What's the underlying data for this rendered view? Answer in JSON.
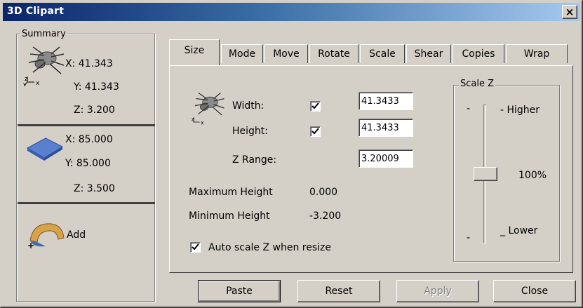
{
  "window": {
    "title": "3D Clipart",
    "close_glyph": "×"
  },
  "summary": {
    "legend": "Summary",
    "model": {
      "icon": "spider-model-icon",
      "x": "X: 41.343",
      "y": "Y: 41.343",
      "z": "Z: 3.200"
    },
    "material": {
      "icon": "material-block-icon",
      "x": "X: 85.000",
      "y": "Y: 85.000",
      "z": "Z: 3.500"
    },
    "add": {
      "icon": "add-dome-icon",
      "label": "Add"
    }
  },
  "tabs": [
    "Size",
    "Mode",
    "Move",
    "Rotate",
    "Scale",
    "Shear",
    "Copies",
    "Wrap"
  ],
  "active_tab": "Size",
  "size": {
    "width_label": "Width:",
    "height_label": "Height:",
    "zrange_label": "Z Range:",
    "width_value": "41.3433",
    "height_value": "41.3433",
    "zrange_value": "3.20009",
    "width_checked": true,
    "height_checked": true,
    "max_height_label": "Maximum Height",
    "max_height_value": "0.000",
    "min_height_label": "Minimum Height",
    "min_height_value": "-3.200",
    "auto_scale_label": "Auto scale Z when resize",
    "auto_scale_checked": true
  },
  "scale_z": {
    "legend": "Scale Z",
    "higher": "- Higher",
    "percent": "100%",
    "lower": "_ Lower",
    "slider_level_percent": 50
  },
  "buttons": {
    "paste": "Paste",
    "reset": "Reset",
    "apply": "Apply",
    "close": "Close"
  },
  "colors": {
    "title_start": "#0a246a",
    "title_end": "#a6caf0",
    "face": "#d4d0c8",
    "disabled": "#808080"
  }
}
